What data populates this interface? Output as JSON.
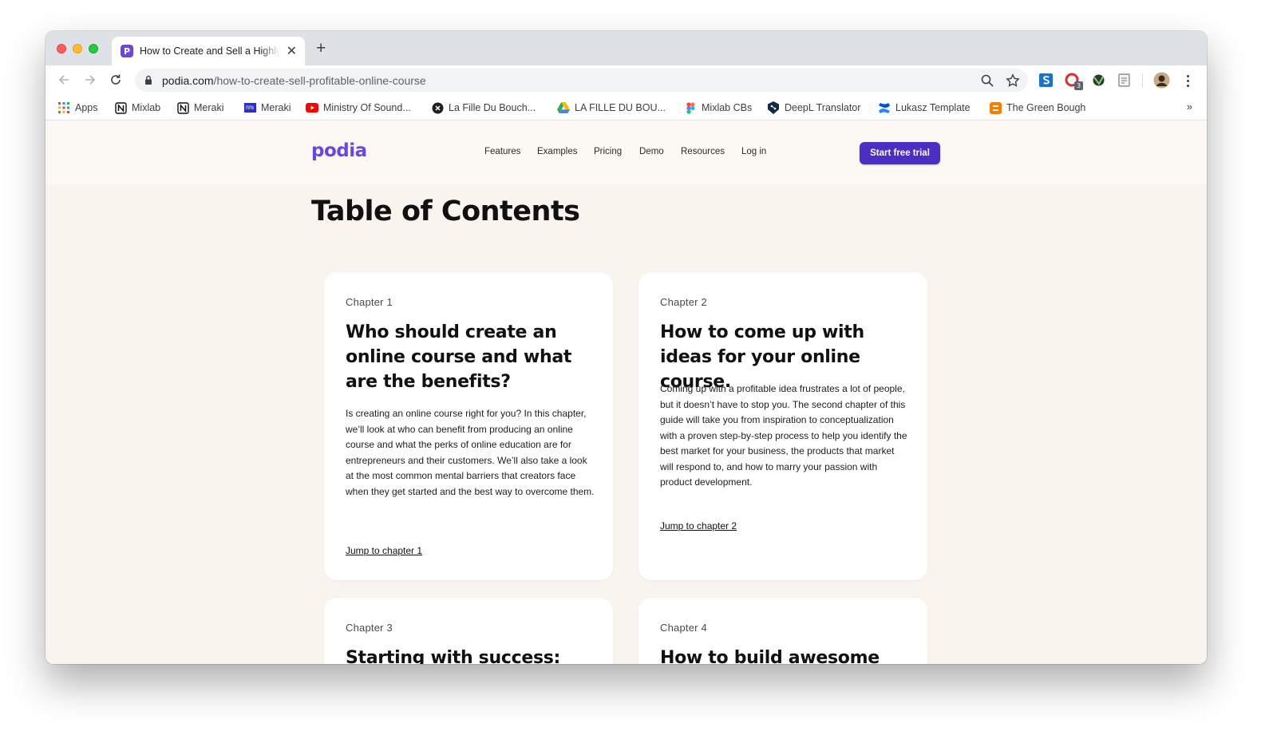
{
  "browser": {
    "tab": {
      "title": "How to Create and Sell a Highly Profitable Online Course",
      "favicon_letter": "P"
    },
    "new_tab_symbol": "+",
    "url": {
      "domain": "podia.com",
      "path": "/how-to-create-sell-profitable-online-course"
    },
    "extension_badge": "3",
    "bookmarks": [
      {
        "label": "Apps",
        "icon": "apps-grid-icon"
      },
      {
        "label": "Mixlab",
        "icon": "notion-icon"
      },
      {
        "label": "Meraki",
        "icon": "notion-icon"
      },
      {
        "label": "Meraki",
        "icon": "meraki-icon"
      },
      {
        "label": "Ministry Of Sound...",
        "icon": "youtube-icon"
      },
      {
        "label": "La Fille Du Bouch...",
        "icon": "close-circle-icon"
      },
      {
        "label": "LA FILLE DU BOU...",
        "icon": "google-drive-icon"
      },
      {
        "label": "Mixlab CBs",
        "icon": "figma-icon"
      },
      {
        "label": "DeepL Translator",
        "icon": "deepl-icon"
      },
      {
        "label": "Lukasz Template",
        "icon": "confluence-icon"
      },
      {
        "label": "The Green Bough",
        "icon": "blogger-icon"
      }
    ],
    "bookmarks_more": "»"
  },
  "site": {
    "logo": "podia",
    "nav": [
      "Features",
      "Examples",
      "Pricing",
      "Demo",
      "Resources",
      "Log in"
    ],
    "cta": "Start free trial"
  },
  "toc": {
    "title": "Table of Contents",
    "chapters": [
      {
        "label": "Chapter 1",
        "heading": "Who should create an online course and what are the benefits?",
        "body": "Is creating an online course right for you? In this chapter, we’ll look at who can benefit from producing an online course and what the perks of online education are for entrepreneurs and their customers. We’ll also take a look at the most common mental barriers that creators face when they get started and the best way to overcome them.",
        "link": "Jump to chapter 1"
      },
      {
        "label": "Chapter 2",
        "heading": "How to come up with ideas for your online course.",
        "body": "Coming up with a profitable idea frustrates a lot of people, but it doesn’t have to stop you. The second chapter of this guide will take you from inspiration to conceptualization with a proven step-by-step process to help you identify the best market for your business, the products that market will respond to, and how to marry your passion with product development.",
        "link": "Jump to chapter 2"
      },
      {
        "label": "Chapter 3",
        "heading": "Starting with success: how to plan your course"
      },
      {
        "label": "Chapter 4",
        "heading": "How to build awesome online course content (with"
      }
    ]
  },
  "colors": {
    "brand": "#6b46e0",
    "cta": "#4a2fc4",
    "page_background": "#f9f4ee",
    "card": "#ffffff"
  }
}
